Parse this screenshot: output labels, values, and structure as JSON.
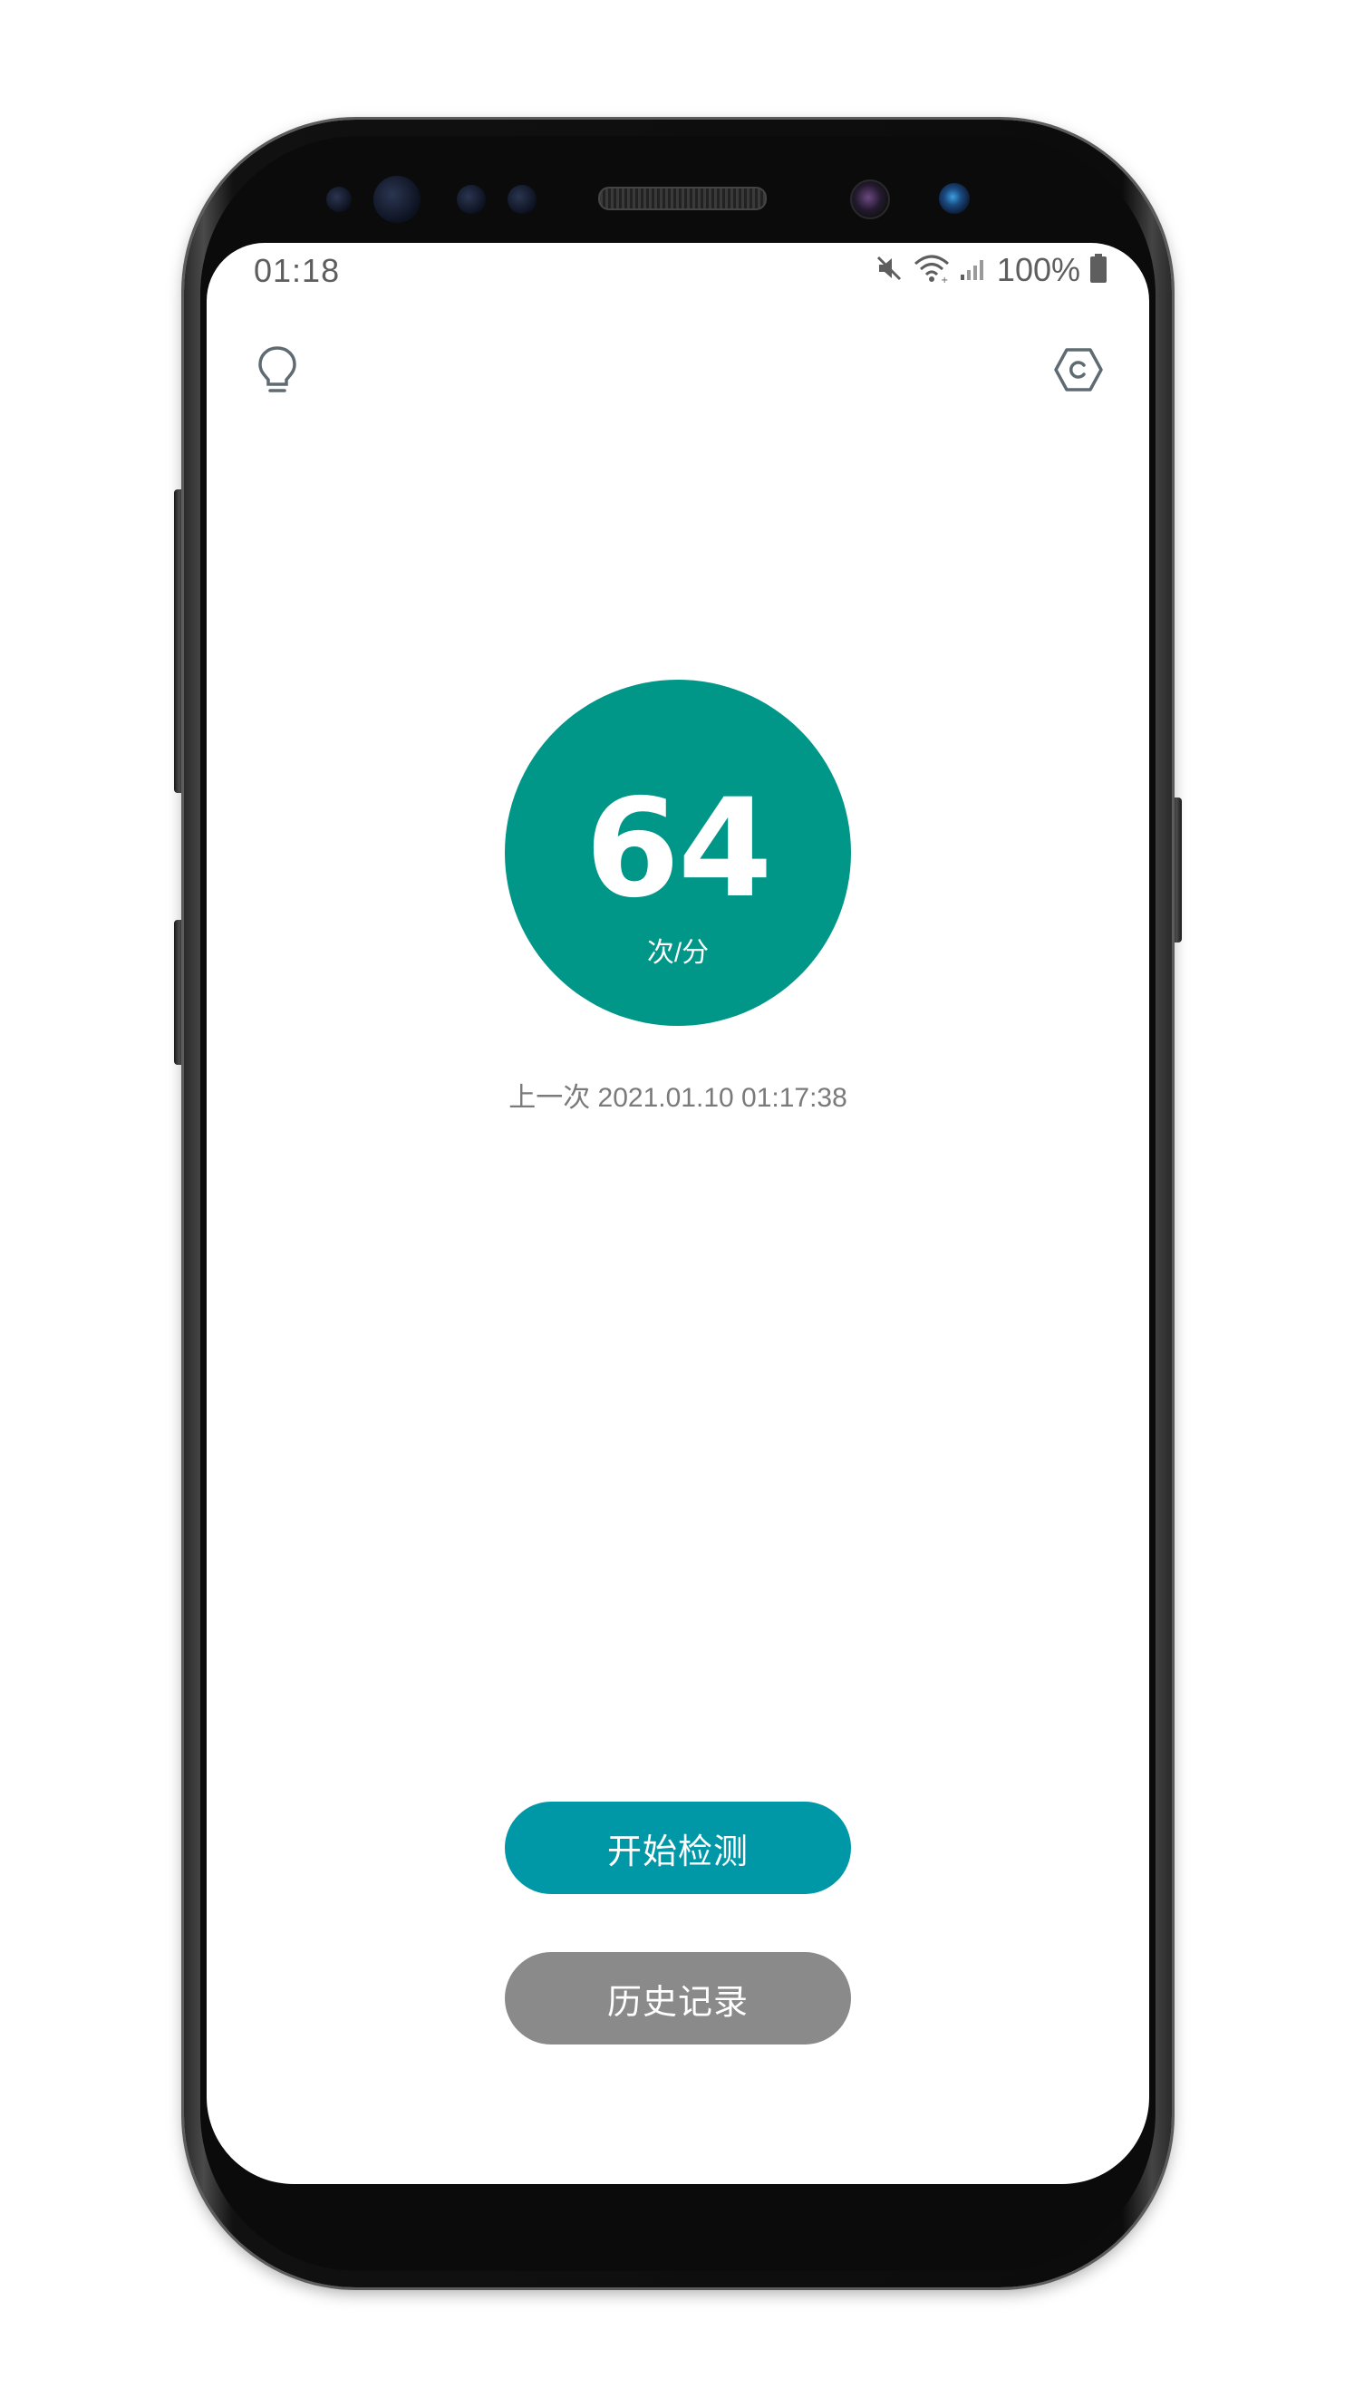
{
  "status_bar": {
    "time": "01:18",
    "battery_text": "100%",
    "icons": [
      "mute-icon",
      "wifi-icon",
      "signal-icon",
      "battery-icon"
    ]
  },
  "toolbar": {
    "left_icon": "lightbulb-icon",
    "right_icon": "settings-hex-icon"
  },
  "heart_rate": {
    "value": "64",
    "unit": "次/分",
    "last_label": "上一次 2021.01.10 01:17:38"
  },
  "actions": {
    "start_label": "开始检测",
    "history_label": "历史记录"
  },
  "colors": {
    "circle": "#009688",
    "start_button": "#0097a7",
    "history_button": "#8a8a8a"
  }
}
